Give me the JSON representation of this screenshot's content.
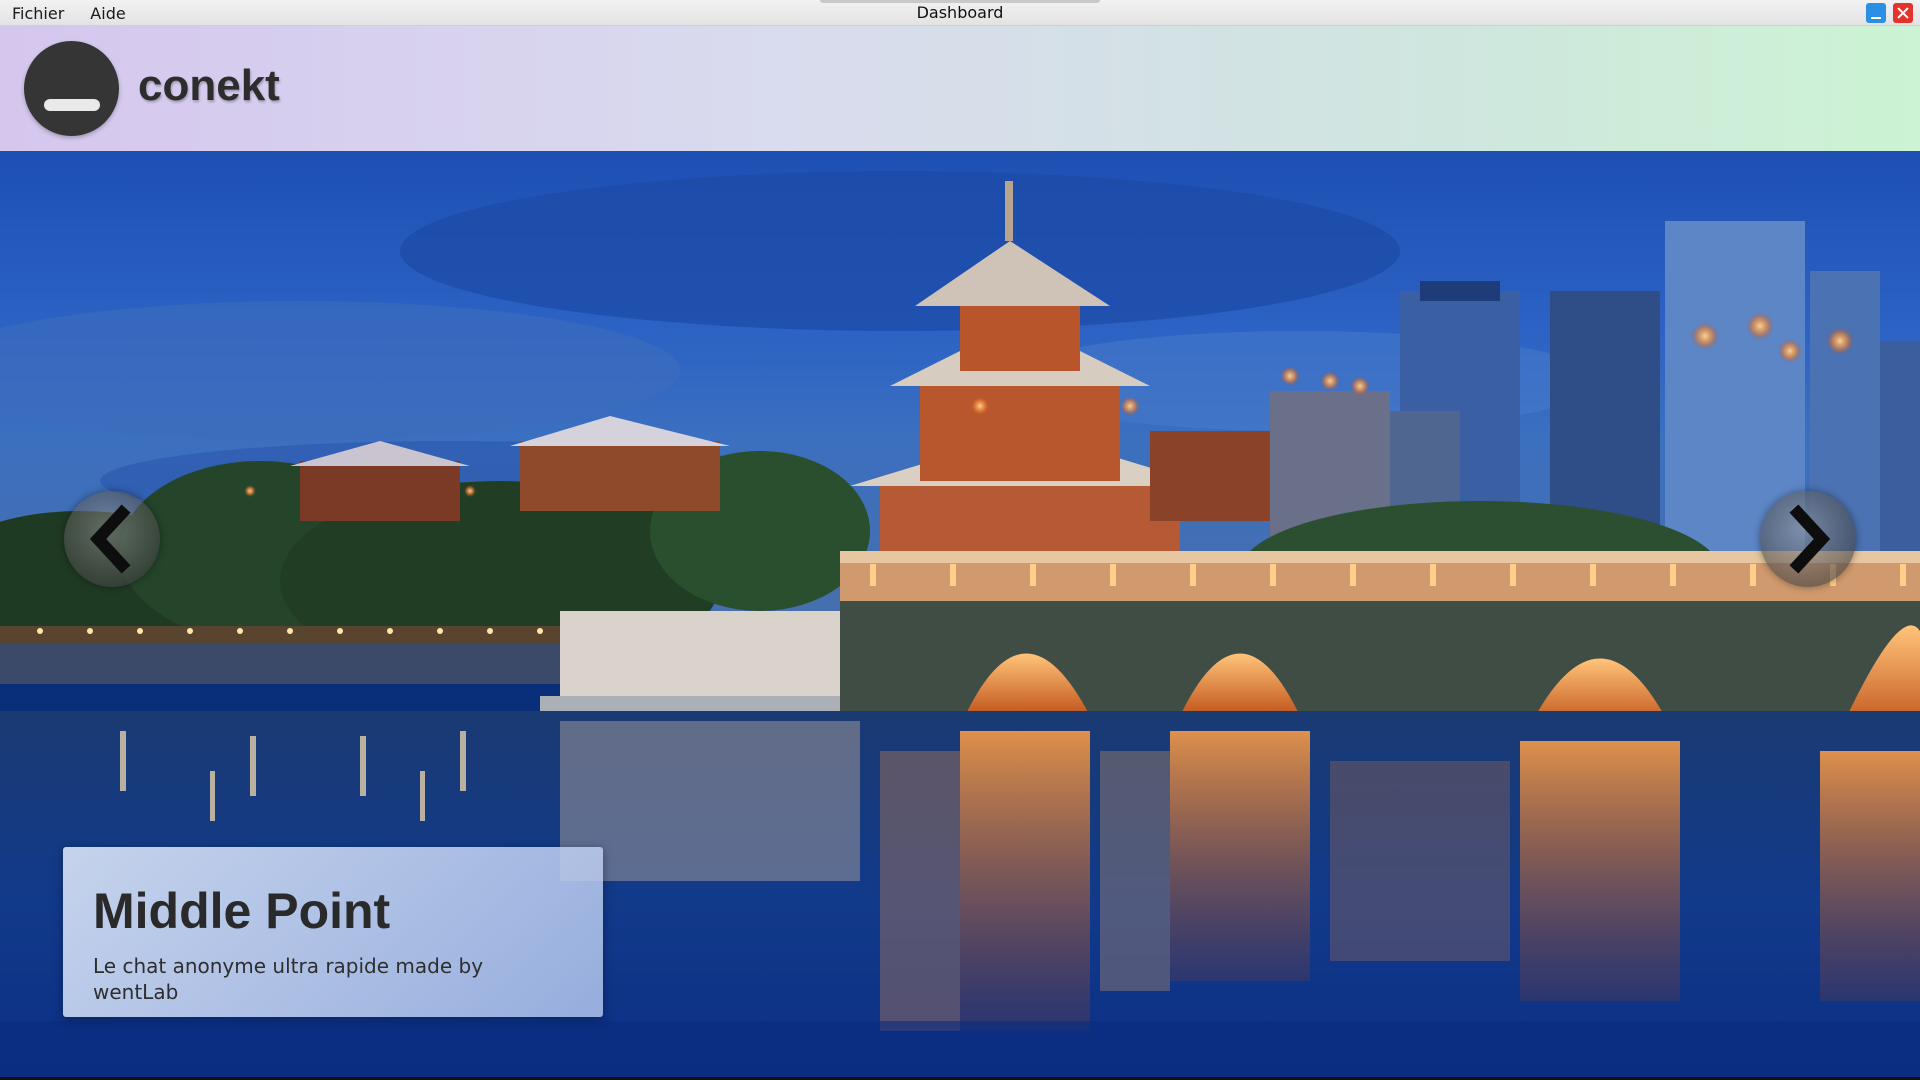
{
  "window": {
    "title": "Dashboard",
    "menu": [
      "Fichier",
      "Aide"
    ],
    "controls": {
      "minimize": "minimize-icon",
      "close": "close-icon"
    },
    "colors": {
      "minimize": "#2b8fe6",
      "close": "#e2342c"
    }
  },
  "header": {
    "brand": "conekt",
    "avatar_icon": "user-avatar-icon",
    "gradient": [
      "#d5c6ee",
      "#ccf3d3"
    ]
  },
  "carousel": {
    "prev_icon": "chevron-left-icon",
    "next_icon": "chevron-right-icon",
    "slide": {
      "title": "Middle Point",
      "subtitle": "Le chat anonyme ultra rapide made by wentLab",
      "image": "night-city-pagoda-bridge-photo"
    }
  }
}
